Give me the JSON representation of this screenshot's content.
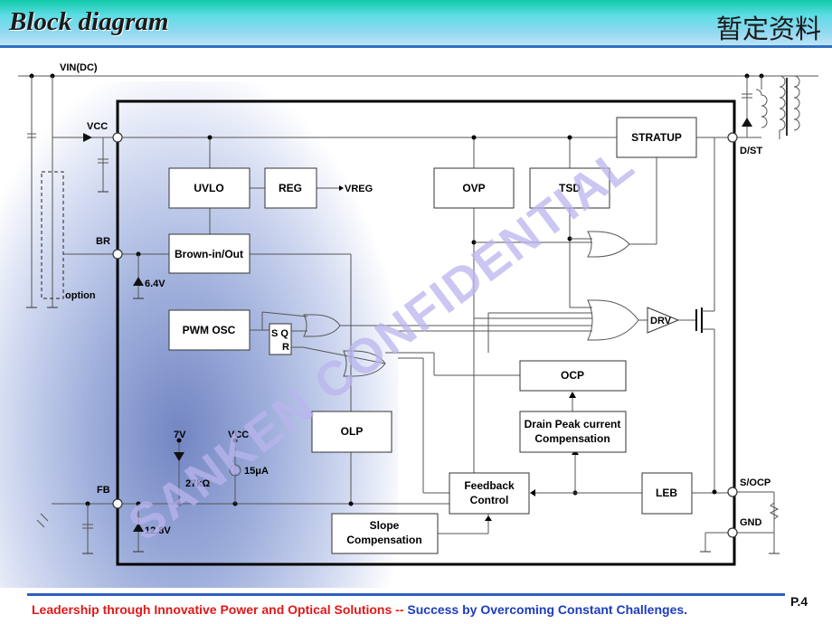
{
  "header": {
    "title": "Block diagram",
    "title_right": "暂定资料"
  },
  "watermark": "SANKEN CONFIDENTIAL",
  "blocks": {
    "uvlo": "UVLO",
    "reg": "REG",
    "ovp": "OVP",
    "tsd": "TSD",
    "startup": "STRATUP",
    "brown": "Brown-in/Out",
    "pwm": "PWM OSC",
    "ocp": "OCP",
    "dpc1": "Drain Peak current",
    "dpc2": "Compensation",
    "olp": "OLP",
    "fb1": "Feedback",
    "fb2": "Control",
    "leb": "LEB",
    "slope1": "Slope",
    "slope2": "Compensation",
    "drv": "DRV",
    "latch_sq": "S Q",
    "latch_r": "R"
  },
  "labels": {
    "vin": "VIN(DC)",
    "vcc": "VCC",
    "br": "BR",
    "option": "option",
    "v64": "6.4V",
    "vreg": "VREG",
    "v7": "7V",
    "vcc2": "VCC",
    "i15": "15μA",
    "r27": "27kΩ",
    "fb": "FB",
    "v128": "12.8V",
    "dst": "D/ST",
    "socp": "S/OCP",
    "gnd": "GND"
  },
  "footer": {
    "left": "Leadership through Innovative Power and Optical Solutions",
    "sep": "--",
    "right": "Success by Overcoming Constant Challenges.",
    "page": "P.4"
  }
}
